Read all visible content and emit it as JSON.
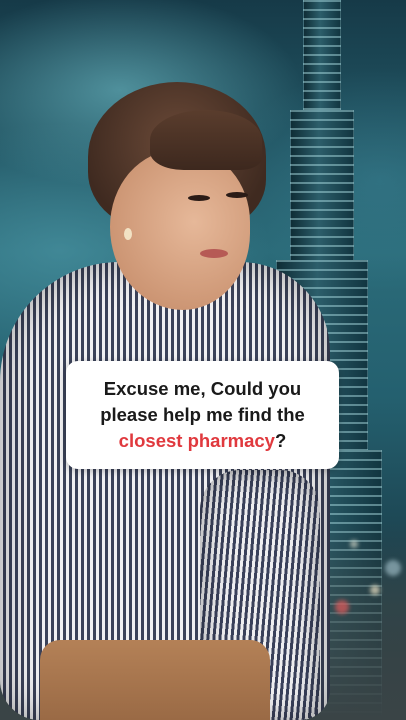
{
  "caption": {
    "line1": "Excuse me, Could you",
    "line2": "please help me find the",
    "highlight": "closest pharmacy",
    "suffix": "?"
  },
  "colors": {
    "highlight": "#e0393e",
    "caption_background": "#ffffff",
    "caption_text": "#1a1a1a"
  }
}
